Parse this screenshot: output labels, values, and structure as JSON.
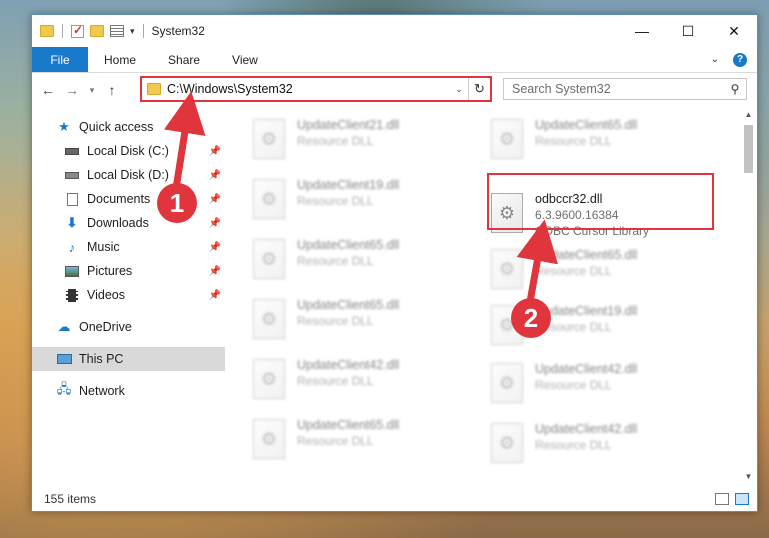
{
  "window": {
    "title": "System32"
  },
  "title_controls": {
    "minimize": "—",
    "maximize": "☐",
    "close": "✕"
  },
  "ribbon": {
    "tabs": [
      "File",
      "Home",
      "Share",
      "View"
    ]
  },
  "address": {
    "path": "C:\\Windows\\System32"
  },
  "search": {
    "placeholder": "Search System32"
  },
  "sidebar": {
    "items": [
      {
        "label": "Quick access",
        "icon": "star-icon"
      },
      {
        "label": "Local Disk (C:)",
        "icon": "drive-icon"
      },
      {
        "label": "Local Disk (D:)",
        "icon": "drive-icon"
      },
      {
        "label": "Documents",
        "icon": "documents-icon"
      },
      {
        "label": "Downloads",
        "icon": "downloads-icon"
      },
      {
        "label": "Music",
        "icon": "music-icon"
      },
      {
        "label": "Pictures",
        "icon": "pictures-icon"
      },
      {
        "label": "Videos",
        "icon": "videos-icon"
      },
      {
        "label": "OneDrive",
        "icon": "cloud-icon"
      },
      {
        "label": "This PC",
        "icon": "pc-icon"
      },
      {
        "label": "Network",
        "icon": "network-icon"
      }
    ]
  },
  "files": {
    "left": [
      {
        "name": "UpdateClient21.dll",
        "sub": "Resource DLL"
      },
      {
        "name": "UpdateClient19.dll",
        "sub": "Resource DLL"
      },
      {
        "name": "UpdateClient65.dll",
        "sub": "Resource DLL"
      },
      {
        "name": "UpdateClient65.dll",
        "sub": "Resource DLL"
      },
      {
        "name": "UpdateClient42.dll",
        "sub": "Resource DLL"
      },
      {
        "name": "UpdateClient65.dll",
        "sub": "Resource DLL"
      }
    ],
    "right": [
      {
        "name": "UpdateClient65.dll",
        "sub": "Resource DLL"
      },
      {
        "name": "UpdateClient65.dll",
        "sub": "Resource DLL"
      },
      {
        "name": "UpdateClient19.dll",
        "sub": "Resource DLL"
      },
      {
        "name": "UpdateClient42.dll",
        "sub": "Resource DLL"
      },
      {
        "name": "UpdateClient42.dll",
        "sub": "Resource DLL"
      }
    ],
    "highlighted": {
      "name": "odbccr32.dll",
      "version": "6.3.9600.16384",
      "description": "ODBC Cursor Library"
    }
  },
  "status": {
    "items_count": "155 items"
  },
  "annotations": {
    "step1": "1",
    "step2": "2",
    "color": "#e0353d"
  }
}
